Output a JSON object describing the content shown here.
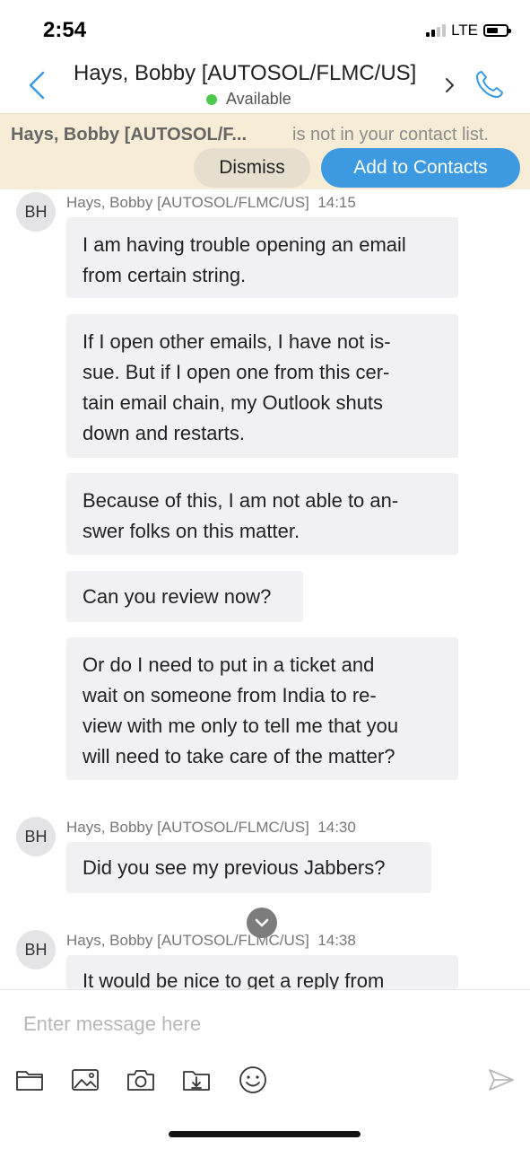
{
  "status_bar": {
    "time": "2:54",
    "network": "LTE",
    "signal_bars_on": 2,
    "signal_bars_total": 4,
    "battery_level": 0.6
  },
  "header": {
    "contact_name": "Hays, Bobby [AUTOSOL/FLMC/US]",
    "presence": "Available",
    "presence_color": "#4cc84c",
    "accent_color": "#3d9ae0"
  },
  "banner": {
    "name": "Hays, Bobby [AUTOSOL/F...",
    "message": "is not in your contact list.",
    "dismiss_label": "Dismiss",
    "add_label": "Add to Contacts"
  },
  "messages": [
    {
      "initials": "BH",
      "sender": "Hays, Bobby [AUTOSOL/FLMC/US]",
      "time": "14:15",
      "bubbles": [
        {
          "lines": [
            "I am having trouble opening an email",
            "from certain string."
          ]
        },
        {
          "lines": [
            "If I open other emails, I have not is-",
            "sue.  But if I open one from this cer-",
            "tain email chain, my Outlook shuts",
            "down and restarts."
          ]
        },
        {
          "lines": [
            "Because of this, I am not able to an-",
            "swer folks on this matter."
          ]
        },
        {
          "lines": [
            "Can you review now?"
          ]
        },
        {
          "lines": [
            "Or do I need to put in a ticket and",
            "wait on someone from India to re-",
            "view with me only to tell me that you",
            "will need to take care of the matter?"
          ]
        }
      ]
    },
    {
      "initials": "BH",
      "sender": "Hays, Bobby [AUTOSOL/FLMC/US]",
      "time": "14:30",
      "bubbles": [
        {
          "lines": [
            "Did you see my previous Jabbers?"
          ]
        }
      ]
    },
    {
      "initials": "BH",
      "sender": "Hays, Bobby [AUTOSOL/FLMC/US]",
      "time": "14:38",
      "bubbles": [
        {
          "lines": [
            "It would be nice to get a reply from"
          ]
        }
      ]
    }
  ],
  "composer": {
    "placeholder": "Enter message here",
    "tools": [
      "folder-icon",
      "image-icon",
      "camera-icon",
      "file-transfer-icon",
      "emoji-icon"
    ],
    "send_icon": "send-icon"
  }
}
